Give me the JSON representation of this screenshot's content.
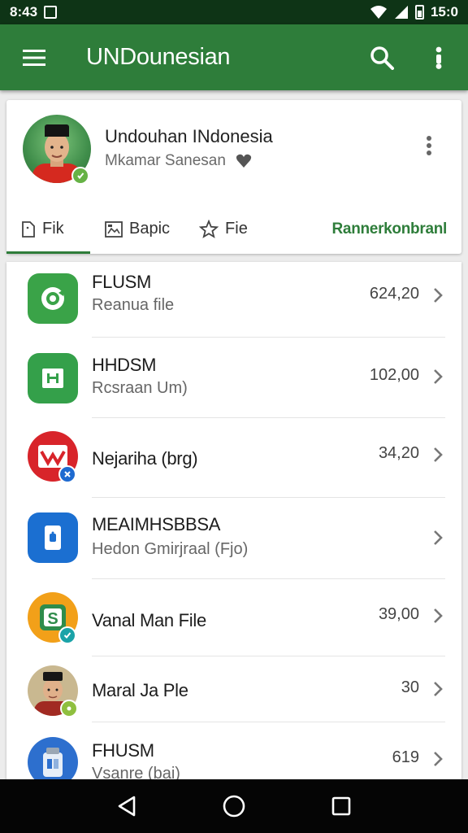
{
  "status_bar": {
    "time": "8:43",
    "battery": "15:0"
  },
  "app_bar": {
    "title": "UNDounesian"
  },
  "profile": {
    "name": "Undouhan INdonesia",
    "subtitle": "Mkamar Sanesan"
  },
  "tabs": [
    {
      "label": "Fik"
    },
    {
      "label": "Bapic"
    },
    {
      "label": "Fie"
    }
  ],
  "tab_action": "Rannerkonbranl",
  "items": [
    {
      "title": "FLUSM",
      "subtitle": "Reanua file",
      "value": "624,20",
      "icon_color": "#3aa348",
      "icon": "camera-icon"
    },
    {
      "title": "HHDSM",
      "subtitle": "Rcsraan Um)",
      "value": "102,00",
      "icon_color": "#34a04a",
      "icon": "sheet-icon"
    },
    {
      "title": "Nejariha (brg)",
      "subtitle": "",
      "value": "34,20",
      "icon_color": "#d8242a",
      "icon": "mail-icon"
    },
    {
      "title": "MEAIMHSBBSA",
      "subtitle": "Hedon Gmirjraal (Fjo)",
      "value": "",
      "icon_color": "#1b6fd1",
      "icon": "phone-icon"
    },
    {
      "title": "Vanal Man File",
      "subtitle": "",
      "value": "39,00",
      "icon_color": "#f2a019",
      "icon": "s-app-icon"
    },
    {
      "title": "Maral Ja Ple",
      "subtitle": "",
      "value": "30",
      "icon_color": "#c9b890",
      "icon": "person-icon"
    },
    {
      "title": "FHUSM",
      "subtitle": "Vsanre (bai)",
      "value": "619",
      "icon_color": "#2d6fce",
      "icon": "jar-icon"
    }
  ]
}
